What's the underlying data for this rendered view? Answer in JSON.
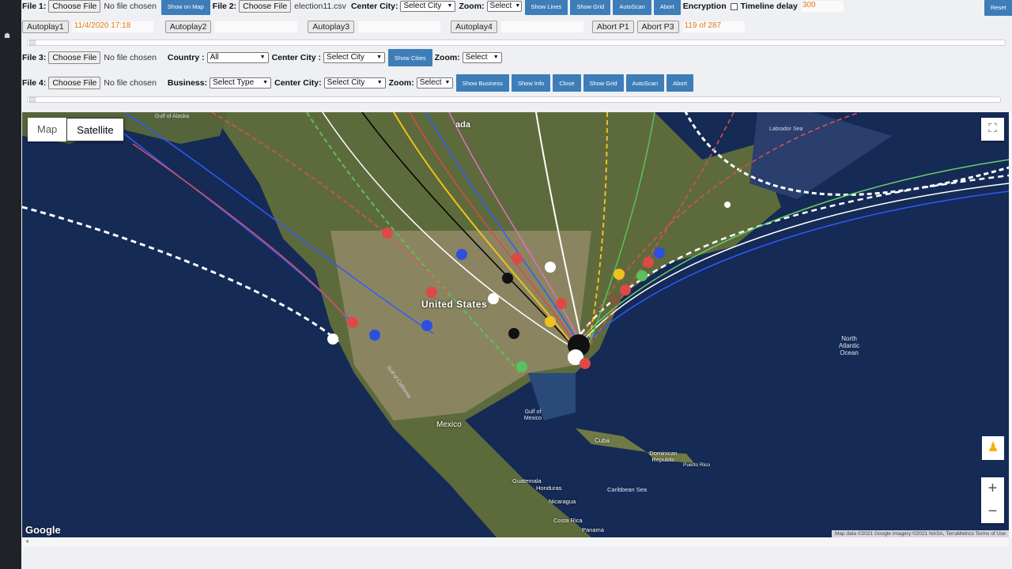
{
  "row1": {
    "file1_label": "File 1:",
    "choose_file": "Choose File",
    "no_file": "No file chosen",
    "show_on_map": "Show on Map",
    "file2_label": "File 2:",
    "file2_name": "election11.csv",
    "center_city_label": "Center City:",
    "center_city_value": "Select City",
    "zoom_label": "Zoom:",
    "zoom_value": "Select",
    "show_lines": "Show Lines",
    "show_grid": "Show Grid",
    "autoscan": "AutoScan",
    "abort": "Abort",
    "encryption_label": "Encryption",
    "timeline_label": "Timeline delay",
    "timeline_value": "300",
    "reset": "Reset"
  },
  "row2": {
    "autoplay1": "Autoplay1",
    "autoplay1_time": "11/4/2020 17:18",
    "autoplay2": "Autoplay2",
    "autoplay3": "Autoplay3",
    "autoplay4": "Autoplay4",
    "abort_p1": "Abort P1",
    "abort_p3": "Abort P3",
    "progress": "119 of 287"
  },
  "row3": {
    "file3_label": "File 3:",
    "choose_file": "Choose File",
    "no_file": "No file chosen",
    "country_label": "Country :",
    "country_value": "All",
    "center_city_label": "Center City :",
    "center_city_value": "Select City",
    "show_cities": "Show Cities",
    "zoom_label": "Zoom:",
    "zoom_value": "Select"
  },
  "row4": {
    "file4_label": "File 4:",
    "choose_file": "Choose File",
    "no_file": "No file chosen",
    "business_label": "Business:",
    "business_value": "Select Type",
    "center_city_label": "Center City:",
    "center_city_value": "Select City",
    "zoom_label": "Zoom:",
    "zoom_value": "Select",
    "show_business": "Show Business",
    "show_info": "Show Info",
    "close": "Close",
    "show_grid": "Show Grid",
    "autoscan": "AutoScan",
    "abort": "Abort"
  },
  "map": {
    "type_map": "Map",
    "type_satellite": "Satellite",
    "fullscreen_icon": "fullscreen-icon",
    "pegman_icon": "pegman-icon",
    "zoom_in": "+",
    "zoom_out": "−",
    "google": "Google",
    "attribution": "Map data ©2021 Google Imagery ©2021 NASA, TerraMetrics    Terms of Use",
    "labels": {
      "us": "United States",
      "mexico": "Mexico",
      "gulf": "Gulf of Mexico",
      "north_atlantic": "North Atlantic Ocean",
      "cuba": "Cuba",
      "dominican": "Dominican Republic",
      "puerto_rico": "Puerto Rico",
      "caribbean": "Caribbean Sea",
      "guatemala": "Guatemala",
      "honduras": "Honduras",
      "nicaragua": "Nicaragua",
      "costa_rica": "Costa Rica",
      "panama": "Panama",
      "labrador": "Labrador Sea",
      "gulf_alaska": "Gulf of Alaska",
      "gulf_california": "Gulf of California",
      "ada": "ada"
    }
  },
  "colors": {
    "button_blue": "#3d7eb8",
    "orange_text": "#e07b1a",
    "ocean": "#14264d",
    "land": "#5d6b3c"
  }
}
